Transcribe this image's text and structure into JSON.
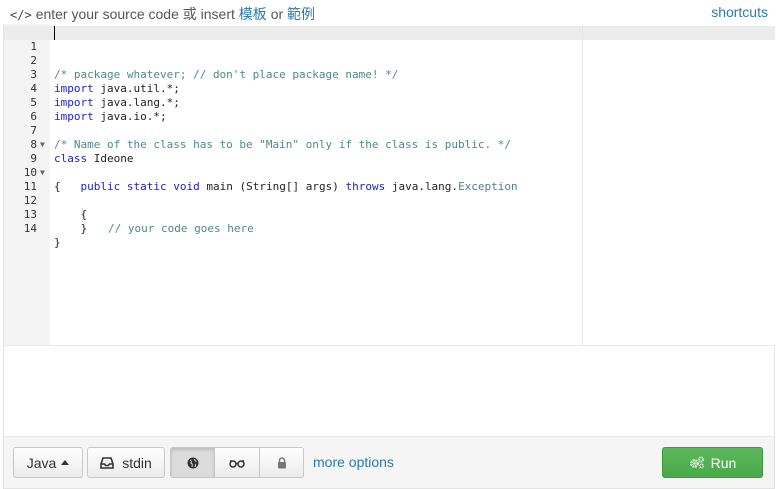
{
  "header": {
    "icon": "code-icon",
    "prompt_text": "enter your source code 或 insert",
    "template_link": "模板",
    "or_text": "or",
    "sample_link": "範例",
    "shortcuts_link": "shortcuts"
  },
  "editor": {
    "line_numbers": [
      "1",
      "2",
      "3",
      "4",
      "5",
      "6",
      "7",
      "8",
      "9",
      "10",
      "11",
      "12",
      "13",
      "14"
    ],
    "lines": {
      "l1": "/* package whatever; // don't place package name! */",
      "l3_kw": "import",
      "l3_rest": " java.util.*;",
      "l4_kw": "import",
      "l4_rest": " java.lang.*;",
      "l5_kw": "import",
      "l5_rest": " java.io.*;",
      "l7": "/* Name of the class has to be \"Main\" only if the class is public. */",
      "l8_kw": "class",
      "l8_rest": " Ideone",
      "l9": "{",
      "l10_indent": "    ",
      "l10_kw1": "public",
      "l10_kw2": "static",
      "l10_kw3": "void",
      "l10_mid": " main (String[] args) ",
      "l10_kw4": "throws",
      "l10_pkg": " java.lang.",
      "l10_cls": "Exception",
      "l11": "    {",
      "l12": "// your code goes here",
      "l13": "    }",
      "l14": "}"
    }
  },
  "toolbar": {
    "language_label": "Java",
    "stdin_label": "stdin",
    "visibility_public_icon": "globe-icon",
    "visibility_hidden_icon": "glasses-icon",
    "visibility_private_icon": "lock-icon",
    "more_options_label": "more options",
    "run_label": "Run",
    "run_icon": "gears-icon"
  },
  "colors": {
    "link": "#2a7ab0",
    "run_button": "#5cb85c",
    "keyword": "#1d1dcf",
    "comment": "#4b8a8a"
  }
}
